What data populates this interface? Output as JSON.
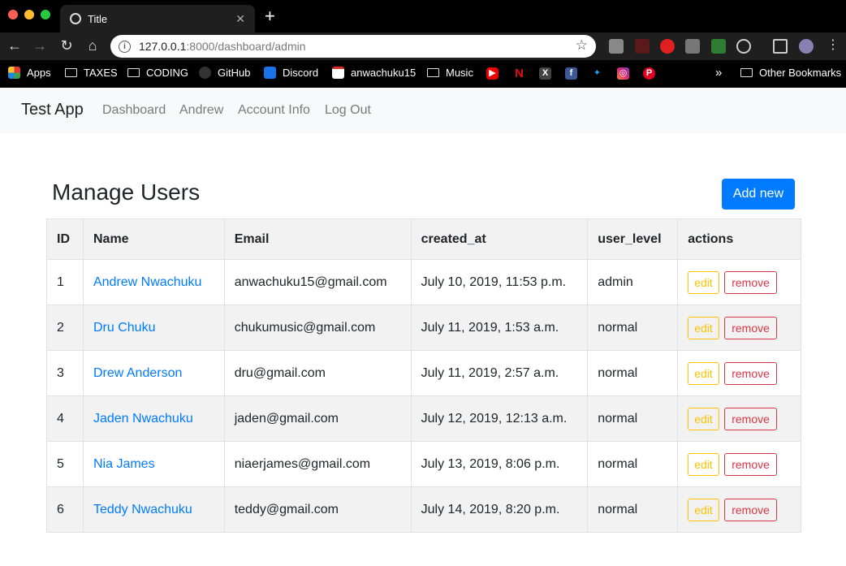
{
  "browser": {
    "tab_title": "Title",
    "url_host": "127.0.0.1",
    "url_path": ":8000/dashboard/admin",
    "bookmarks": {
      "apps": "Apps",
      "taxes": "TAXES",
      "coding": "CODING",
      "github": "GitHub",
      "discord": "Discord",
      "gmail": "anwachuku15",
      "music": "Music",
      "overflow": "»",
      "other": "Other Bookmarks"
    }
  },
  "navbar": {
    "brand": "Test App",
    "links": [
      "Dashboard",
      "Andrew",
      "Account Info",
      "Log Out"
    ]
  },
  "main": {
    "title": "Manage Users",
    "add_label": "Add new",
    "columns": [
      "ID",
      "Name",
      "Email",
      "created_at",
      "user_level",
      "actions"
    ],
    "edit_label": "edit",
    "remove_label": "remove",
    "rows": [
      {
        "id": "1",
        "name": "Andrew Nwachuku",
        "email": "anwachuku15@gmail.com",
        "created_at": "July 10, 2019, 11:53 p.m.",
        "user_level": "admin"
      },
      {
        "id": "2",
        "name": "Dru Chuku",
        "email": "chukumusic@gmail.com",
        "created_at": "July 11, 2019, 1:53 a.m.",
        "user_level": "normal"
      },
      {
        "id": "3",
        "name": "Drew Anderson",
        "email": "dru@gmail.com",
        "created_at": "July 11, 2019, 2:57 a.m.",
        "user_level": "normal"
      },
      {
        "id": "4",
        "name": "Jaden Nwachuku",
        "email": "jaden@gmail.com",
        "created_at": "July 12, 2019, 12:13 a.m.",
        "user_level": "normal"
      },
      {
        "id": "5",
        "name": "Nia James",
        "email": "niaerjames@gmail.com",
        "created_at": "July 13, 2019, 8:06 p.m.",
        "user_level": "normal"
      },
      {
        "id": "6",
        "name": "Teddy Nwachuku",
        "email": "teddy@gmail.com",
        "created_at": "July 14, 2019, 8:20 p.m.",
        "user_level": "normal"
      }
    ]
  },
  "colors": {
    "primary": "#007bff",
    "warning": "#ffc107",
    "danger": "#dc3545"
  }
}
